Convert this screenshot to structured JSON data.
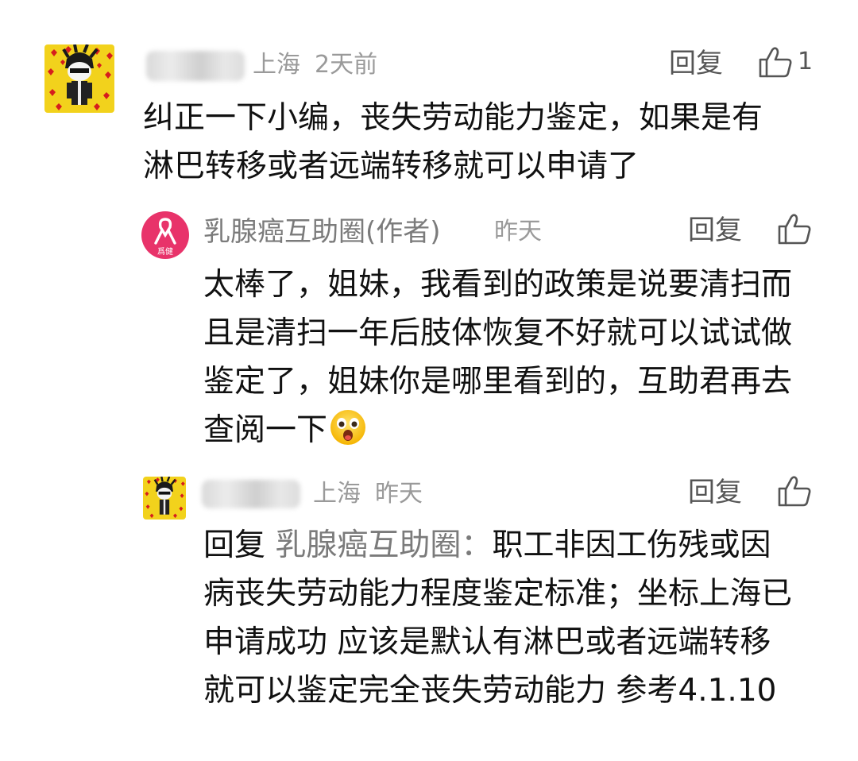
{
  "comments": [
    {
      "location": "上海",
      "time": "2天前",
      "reply_label": "回复",
      "like_count": "1",
      "text_lines": [
        "纠正一下小编，丧失劳动能力鉴定，如果是有",
        "淋巴转移或者远端转移就可以申请了"
      ]
    },
    {
      "author": "乳腺癌互助圈(作者)",
      "avatar_text": "爲健",
      "time": "昨天",
      "reply_label": "回复",
      "text_lines": [
        "太棒了，姐妹，我看到的政策是说要清扫而",
        "且是清扫一年后肢体恢复不好就可以试试做",
        "鉴定了，姐妹你是哪里看到的，互助君再去",
        "查阅一下"
      ],
      "emoji": "surprised-face-emoji"
    },
    {
      "location": "上海",
      "time": "昨天",
      "reply_label": "回复",
      "reply_prefix": "回复",
      "reply_target": "乳腺癌互助圈：",
      "text_lines": [
        "职工非因工伤残或因",
        "病丧失劳动能力程度鉴定标准；坐标上海已",
        "申请成功 应该是默认有淋巴或者远端转移",
        "就可以鉴定完全丧失劳动能力 参考4.1.10"
      ]
    }
  ],
  "colors": {
    "text": "#111111",
    "meta": "#9a9a9a",
    "brand_pink": "#e8336a",
    "avatar_yellow": "#f2d21c"
  }
}
